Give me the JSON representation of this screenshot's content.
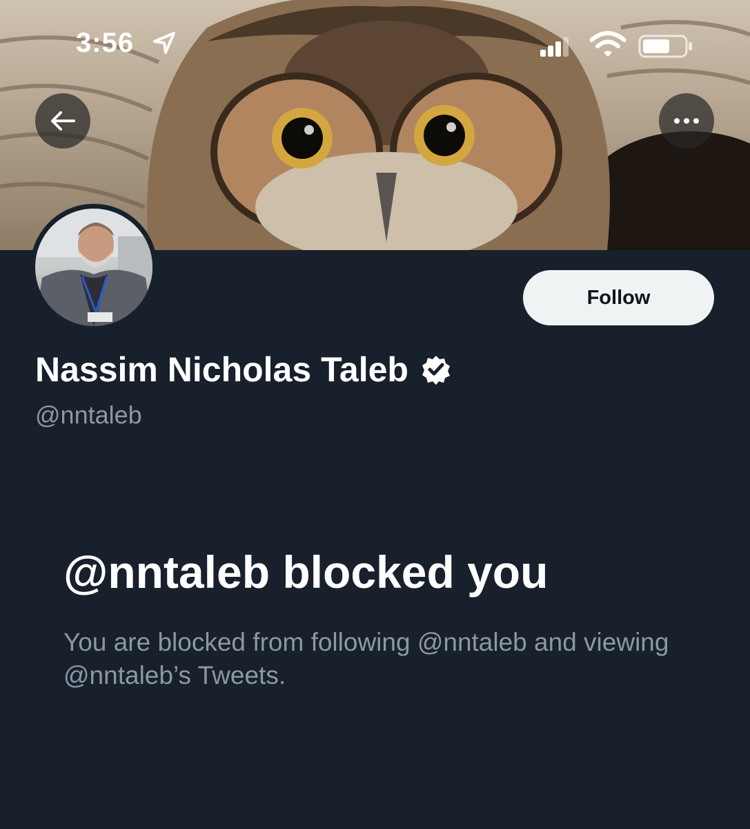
{
  "status_bar": {
    "time": "3:56",
    "location_icon": "location-arrow-icon",
    "signal_icon": "cellular-signal-icon",
    "wifi_icon": "wifi-icon",
    "battery_icon": "battery-icon"
  },
  "header": {
    "back_icon": "arrow-left-icon",
    "more_icon": "ellipsis-icon"
  },
  "profile": {
    "display_name": "Nassim Nicholas Taleb",
    "handle": "@nntaleb",
    "verified_icon": "verified-badge-icon",
    "follow_label": "Follow"
  },
  "blocked": {
    "title": "@nntaleb blocked you",
    "description": "You are blocked from following @nntaleb and viewing @nntaleb’s Tweets."
  },
  "colors": {
    "background": "#17202b",
    "follow_button_bg": "#eff3f4",
    "secondary_text": "#8b98a5"
  }
}
